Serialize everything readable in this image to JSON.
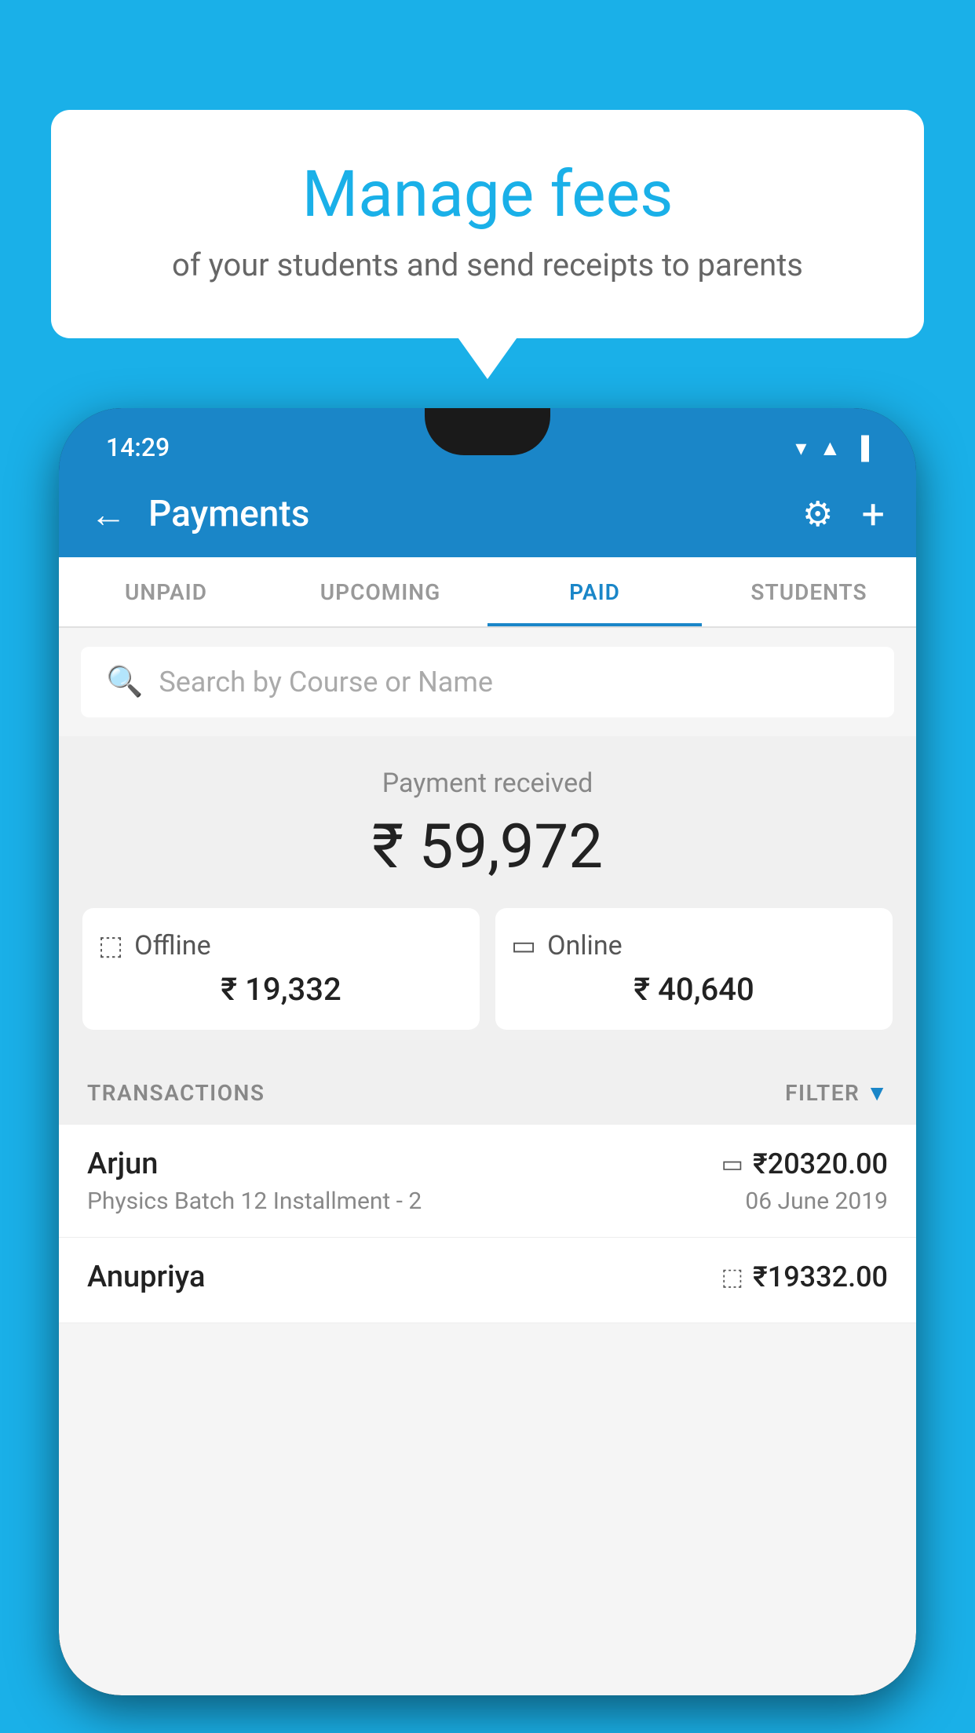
{
  "background_color": "#1ab0e8",
  "bubble": {
    "title": "Manage fees",
    "subtitle": "of your students and send receipts to parents"
  },
  "status_bar": {
    "time": "14:29",
    "wifi": "▼",
    "signal": "▲",
    "battery": "▐"
  },
  "toolbar": {
    "title": "Payments",
    "back_label": "←",
    "gear_label": "⚙",
    "plus_label": "+"
  },
  "tabs": [
    {
      "id": "unpaid",
      "label": "UNPAID",
      "active": false
    },
    {
      "id": "upcoming",
      "label": "UPCOMING",
      "active": false
    },
    {
      "id": "paid",
      "label": "PAID",
      "active": true
    },
    {
      "id": "students",
      "label": "STUDENTS",
      "active": false
    }
  ],
  "search": {
    "placeholder": "Search by Course or Name"
  },
  "payment_received": {
    "label": "Payment received",
    "total": "₹ 59,972",
    "offline": {
      "icon": "💳",
      "label": "Offline",
      "amount": "₹ 19,332"
    },
    "online": {
      "icon": "💳",
      "label": "Online",
      "amount": "₹ 40,640"
    }
  },
  "transactions_section": {
    "header": "TRANSACTIONS",
    "filter": "FILTER"
  },
  "transactions": [
    {
      "name": "Arjun",
      "course": "Physics Batch 12 Installment - 2",
      "amount": "₹20320.00",
      "date": "06 June 2019",
      "payment_type": "online"
    },
    {
      "name": "Anupriya",
      "course": "",
      "amount": "₹19332.00",
      "date": "",
      "payment_type": "offline"
    }
  ]
}
